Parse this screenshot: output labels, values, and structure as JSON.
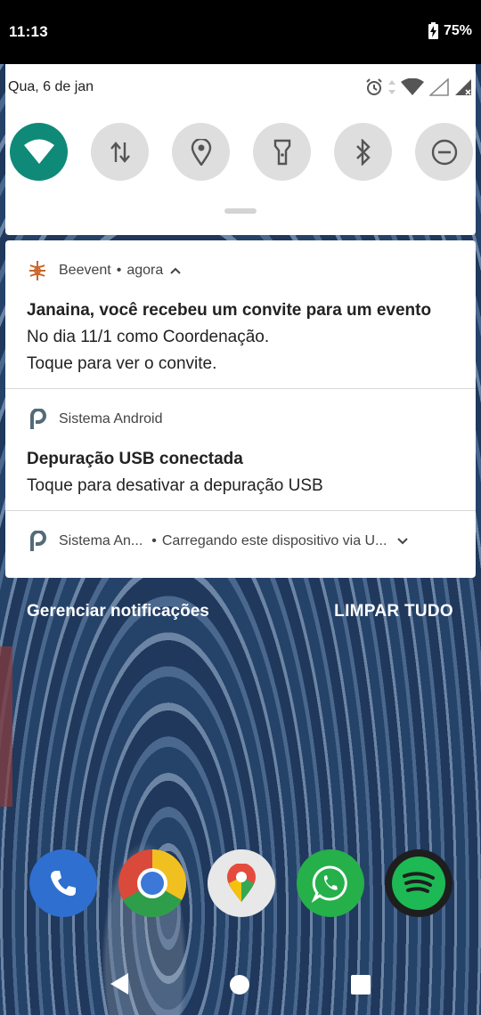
{
  "status_bar": {
    "time": "11:13",
    "battery": "75%"
  },
  "quick_settings": {
    "date": "Qua, 6 de jan",
    "tiles": [
      {
        "name": "wifi",
        "icon": "wifi-icon",
        "active": true
      },
      {
        "name": "mobile-data",
        "icon": "data-arrows-icon",
        "active": false
      },
      {
        "name": "location",
        "icon": "location-pin-icon",
        "active": false
      },
      {
        "name": "flashlight",
        "icon": "flashlight-icon",
        "active": false
      },
      {
        "name": "bluetooth",
        "icon": "bluetooth-icon",
        "active": false
      },
      {
        "name": "do-not-disturb",
        "icon": "do-not-disturb-icon",
        "active": false
      }
    ],
    "accent_color": "#0f8a78"
  },
  "notifications": [
    {
      "app": "Beevent",
      "time": "agora",
      "title": "Janaina, você recebeu um convite para um evento",
      "lines": [
        "No dia 11/1 como Coordenação.",
        "Toque para ver o convite."
      ],
      "icon": "beevent-icon",
      "icon_color": "#c8662a"
    },
    {
      "app": "Sistema Android",
      "title": "Depuração USB conectada",
      "lines": [
        "Toque para desativar a depuração USB"
      ],
      "icon": "android-system-icon",
      "icon_color": "#536b78"
    },
    {
      "app": "Sistema An...",
      "text": "Carregando este dispositivo via U...",
      "icon": "android-system-icon",
      "icon_color": "#536b78"
    }
  ],
  "actions": {
    "manage": "Gerenciar notificações",
    "clear_all": "LIMPAR TUDO"
  },
  "dock": [
    {
      "name": "phone",
      "icon": "phone-icon"
    },
    {
      "name": "chrome",
      "icon": "chrome-icon"
    },
    {
      "name": "maps",
      "icon": "maps-icon"
    },
    {
      "name": "whatsapp",
      "icon": "whatsapp-icon"
    },
    {
      "name": "spotify",
      "icon": "spotify-icon"
    }
  ]
}
